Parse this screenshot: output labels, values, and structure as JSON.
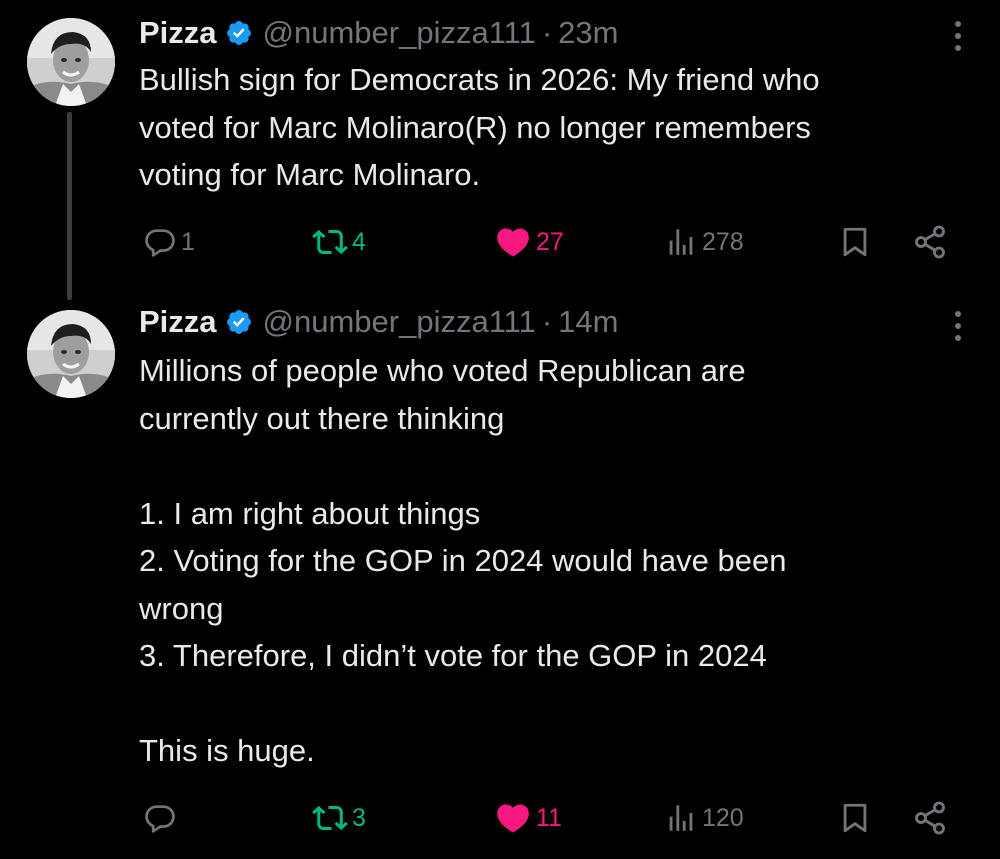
{
  "colors": {
    "background": "#000000",
    "text": "#e7e9ea",
    "muted": "#71767b",
    "verified": "#1d9bf0",
    "retweet": "#00ba7c",
    "like": "#f91880"
  },
  "tweets": [
    {
      "author_name": "Pizza",
      "verified_icon": "verified-badge-icon",
      "handle": "@number_pizza111",
      "separator": "·",
      "time": "23m",
      "text": "Bullish sign for Democrats in 2026: My friend who\nvoted for Marc Molinaro(R) no longer remembers\nvoting for Marc Molinaro.",
      "replies": "1",
      "retweets": "4",
      "likes": "27",
      "views": "278",
      "liked": true
    },
    {
      "author_name": "Pizza",
      "verified_icon": "verified-badge-icon",
      "handle": "@number_pizza111",
      "separator": "·",
      "time": "14m",
      "text": "Millions of people who voted Republican are\ncurrently out there thinking\n\n1. I am right about things\n2. Voting for the GOP in 2024 would have been\nwrong\n3. Therefore, I didn’t vote for the GOP in 2024\n\nThis is huge.",
      "replies": "",
      "retweets": "3",
      "likes": "11",
      "views": "120",
      "liked": true
    }
  ]
}
